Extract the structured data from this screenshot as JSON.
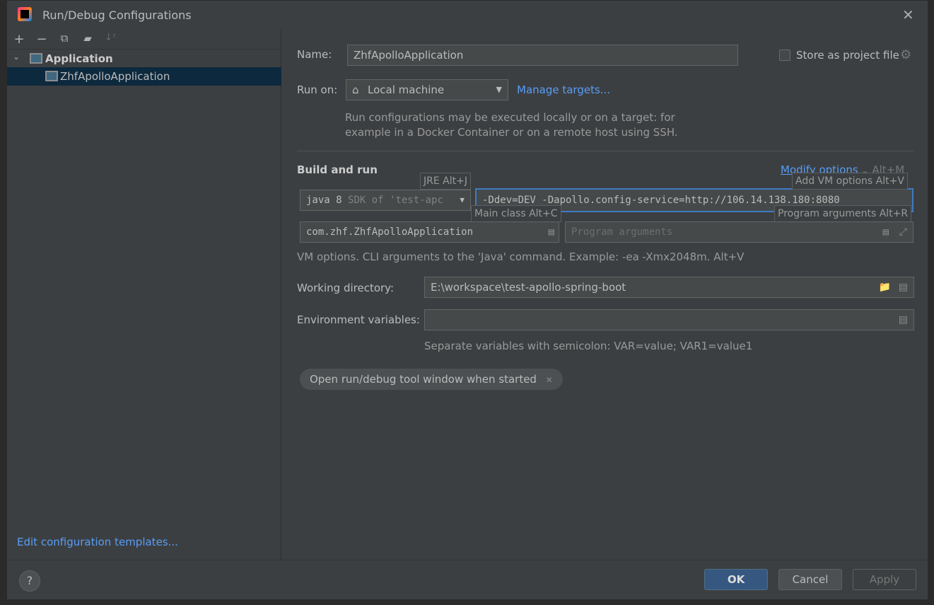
{
  "window": {
    "title": "Run/Debug Configurations"
  },
  "toolbar": {
    "icons": [
      "plus-icon",
      "minus-icon",
      "copy-icon",
      "new-folder-icon",
      "sort-alpha-icon"
    ]
  },
  "tree": {
    "group": "Application",
    "items": [
      {
        "label": "ZhfApolloApplication",
        "selected": true
      }
    ]
  },
  "left_footer": {
    "templates_link": "Edit configuration templates..."
  },
  "form": {
    "name_label": "Name:",
    "name_value": "ZhfApolloApplication",
    "store_label": "Store as project file",
    "store_checked": false,
    "run_on_label": "Run on:",
    "run_on_value": "Local machine",
    "manage_targets": "Manage targets...",
    "run_on_hint_1": "Run configurations may be executed locally or on a target: for",
    "run_on_hint_2": "example in a Docker Container or on a remote host using SSH.",
    "build_and_run": "Build and run",
    "modify_options": "Modify options",
    "modify_shortcut": "Alt+M",
    "jre_main": "java 8",
    "jre_detail": "SDK of 'test-apc",
    "vm_options": "-Ddev=DEV  -Dapollo.config-service=http://106.14.138.180:8080",
    "main_class": "com.zhf.ZhfApolloApplication",
    "program_args_placeholder": "Program arguments",
    "tip_jre": "JRE Alt+J",
    "tip_vm": "Add VM options Alt+V",
    "tip_main": "Main class Alt+C",
    "tip_args": "Program arguments Alt+R",
    "vm_hint": "VM options. CLI arguments to the 'Java' command. Example: -ea -Xmx2048m. Alt+V",
    "workdir_label": "Working directory:",
    "workdir_value": "E:\\workspace\\test-apollo-spring-boot",
    "env_label": "Environment variables:",
    "env_value": "",
    "env_hint": "Separate variables with semicolon: VAR=value; VAR1=value1",
    "chip": "Open run/debug tool window when started"
  },
  "buttons": {
    "ok": "OK",
    "cancel": "Cancel",
    "apply": "Apply",
    "help": "?"
  },
  "colors": {
    "accent": "#365880",
    "link": "#589df6",
    "selection": "#0d293e",
    "focus": "#3d7bc5"
  }
}
